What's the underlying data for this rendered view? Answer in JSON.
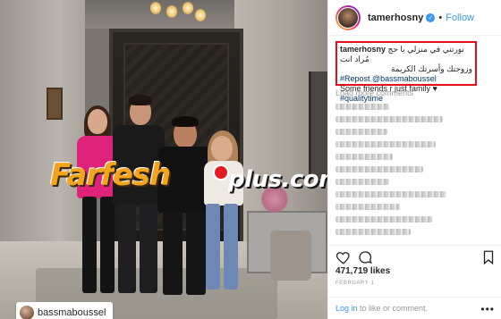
{
  "post": {
    "username": "tamerhosny",
    "verified_icon": "verified-badge-icon",
    "separator": "•",
    "follow_label": "Follow",
    "caption": {
      "user": "tamerhosny",
      "arabic_line1": "نورتني في منزلي يا حج مُراد انت",
      "arabic_line2": "وزوجتك وأسرتك الكريمة",
      "repost_tag": "#Repost @bassmaboussel",
      "text_line": "Some friends r just family",
      "heart": "♥",
      "hashtag": "#qualitytime"
    },
    "load_more": "Load more comments",
    "likes": "471,719 likes",
    "date": "FEBRUARY 1",
    "footer_login": "Log in",
    "footer_text": " to like or comment.",
    "more_icon": "•••"
  },
  "photo": {
    "tagged_user": "bassmaboussel",
    "watermark_main": "Farfesh",
    "watermark_plus": "plus.com"
  },
  "colors": {
    "accent_blue": "#3897f0",
    "hashtag_blue": "#003569",
    "highlight_red": "#e3101c",
    "watermark_orange": "#f3a41c"
  }
}
